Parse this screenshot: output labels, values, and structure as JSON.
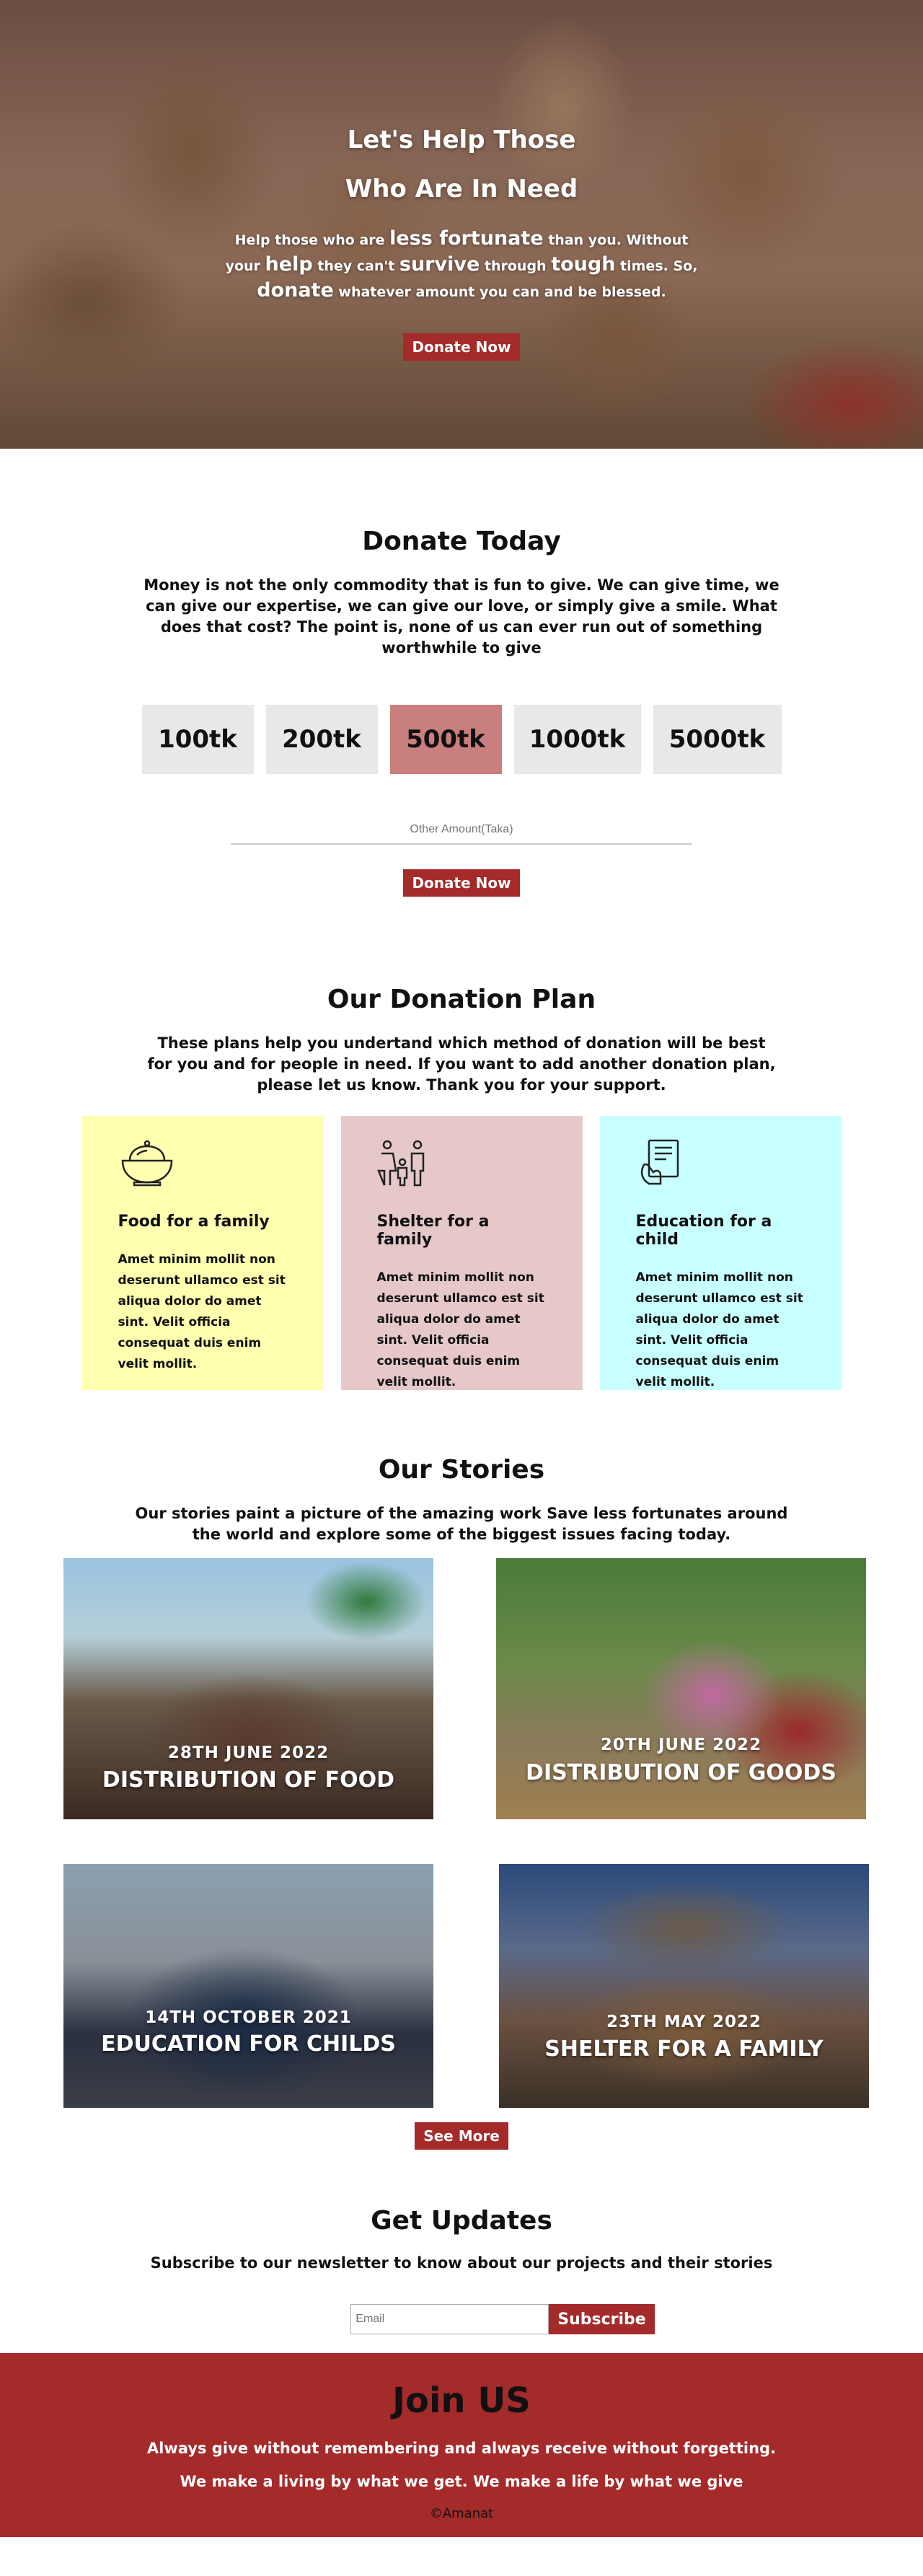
{
  "hero": {
    "title_line1": "Let's Help Those",
    "title_line2": "Who Are In Need",
    "text_1": "Help those who are ",
    "text_less_fortunate": "less fortunate",
    "text_2": " than you. Without your ",
    "text_help": "help",
    "text_3": " they can't ",
    "text_survive": "survive",
    "text_4": " through ",
    "text_tough": "tough",
    "text_5": " times. So, ",
    "text_donate": "donate",
    "text_6": " whatever amount you can and be blessed.",
    "button_label": "Donate Now"
  },
  "donate": {
    "title": "Donate Today",
    "description": "Money is not the only commodity that is fun to give. We can give time, we can give our expertise, we can give our love, or simply give a smile. What does that cost? The point is, none of us can ever run out of something worthwhile to give",
    "amounts": [
      "100tk",
      "200tk",
      "500tk",
      "1000tk",
      "5000tk"
    ],
    "selected_amount": "500tk",
    "other_placeholder": "Other Amount(Taka)",
    "button_label": "Donate Now"
  },
  "plans": {
    "title": "Our Donation Plan",
    "description": "These plans help you undertand which method of donation will be best for you and for people in need. If you want to add another donation plan, please let us know. Thank you for your support.",
    "cards": [
      {
        "icon": "food-bowl-icon",
        "title": "Food for a family",
        "text": "Amet minim mollit non deserunt ullamco est sit aliqua dolor do amet sint. Velit officia consequat duis enim velit mollit.",
        "color": "#ffffb0"
      },
      {
        "icon": "family-icon",
        "title": "Shelter for a family",
        "text": "Amet minim mollit non deserunt ullamco est sit aliqua dolor do amet sint. Velit officia consequat duis enim velit mollit.",
        "color": "#e6c8c9"
      },
      {
        "icon": "education-icon",
        "title": "Education for a child",
        "text": "Amet minim mollit non deserunt ullamco est sit aliqua dolor do amet sint. Velit officia consequat duis enim velit mollit.",
        "color": "#c8ffff"
      }
    ]
  },
  "stories": {
    "title": "Our Stories",
    "description": "Our stories paint a picture of the amazing work Save less fortunates around the world and explore some of the biggest issues facing today.",
    "items": [
      {
        "date": "28TH JUNE 2022",
        "caption": "DISTRIBUTION OF FOOD"
      },
      {
        "date": "20TH JUNE 2022",
        "caption": "DISTRIBUTION OF GOODS"
      },
      {
        "date": "14TH OCTOBER 2021",
        "caption": "EDUCATION FOR CHILDS"
      },
      {
        "date": "23TH MAY 2022",
        "caption": "SHELTER FOR A FAMILY"
      }
    ],
    "button_label": "See More"
  },
  "updates": {
    "title": "Get Updates",
    "description": "Subscribe to our newsletter to know about our projects and their stories",
    "email_placeholder": "Email",
    "button_label": "Subscribe"
  },
  "footer": {
    "title": "Join US",
    "line1": "Always give without remembering and always receive without forgetting.",
    "line2": "We make a living by what we get. We make a life by what we give",
    "copyright": "©Amanat"
  },
  "colors": {
    "accent": "#a52a2a",
    "selected_amount": "#c97f7d",
    "amount_bg": "#e8e8e8"
  }
}
